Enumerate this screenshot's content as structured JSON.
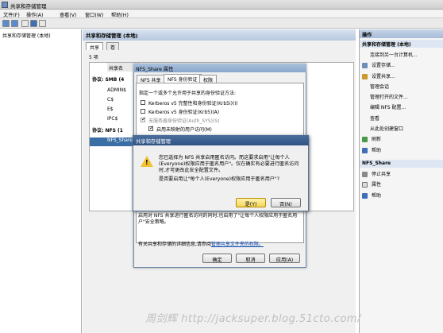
{
  "window": {
    "title": "共享和存储管理"
  },
  "menu": [
    "文件(F)",
    "操作(A)",
    "查看(V)",
    "窗口(W)",
    "帮助(H)"
  ],
  "tree": {
    "root": "共享和存储管理 (本地)"
  },
  "center": {
    "header": "共享和存储管理 (本地)",
    "tabs": [
      "共享",
      "卷"
    ],
    "count": "5 项",
    "column": "共享名",
    "groups": [
      "协议: SMB (4",
      "协议: NFS (1"
    ],
    "items": [
      "ADMIN$",
      "C$",
      "E$",
      "IPC$",
      "NFS_Share"
    ]
  },
  "nfs_dialog": {
    "title": "NFS_Share 属性",
    "tabs": [
      "NFS 共享",
      "NFS 身份验证",
      "权限"
    ],
    "prompt": "指定一个或多个允许用于共享的身份验证方法:",
    "options": [
      "Kerberos v5 完整性和身份验证(Krb5i)(I)",
      "Kerberos v5 身份验证(Krb5)(A)",
      "无服务器身份验证(Auth_SYS)(S)",
      "启用未映射的用户访问(M)"
    ],
    "bottom_text": "启用对 NFS 共享进行匿名访问的同时,也启用了\"让每个人权限应用于匿名用户\"安全策略。",
    "help_prefix": "有关共享和存储的详细信息,请参阅",
    "help_link": "管理共享文件夹的权限。",
    "buttons": [
      "确定",
      "取消",
      "应用(A)"
    ]
  },
  "message": {
    "title": "共享和存储管理",
    "line1": "您已选择为 NFS 共享启用匿名访问。而这要求启用\"让每个人(Everyone)权限应用于匿名用户\"。仅在确实有必要进行匿名访问时,才可更改此安全配置文件。",
    "question": "是否要启用让\"每个人(Everyone)权限应用于匿名用户\"?",
    "yes": "是(Y)",
    "no": "否(N)"
  },
  "actions": {
    "header": "操作",
    "section1": "共享和存储管理 (本地)",
    "items1": [
      "连接到另一台计算机...",
      "设置存储...",
      "设置共享...",
      "管理会话",
      "管理打开的文件...",
      "编辑 NFS 配置...",
      "查看",
      "从此处创建窗口",
      "刷新",
      "帮助"
    ],
    "section2": "NFS_Share",
    "items2": [
      "停止共享",
      "属性",
      "帮助"
    ]
  },
  "watermark": "周剑辉 http://jacksuper.blog.51cto.com/"
}
